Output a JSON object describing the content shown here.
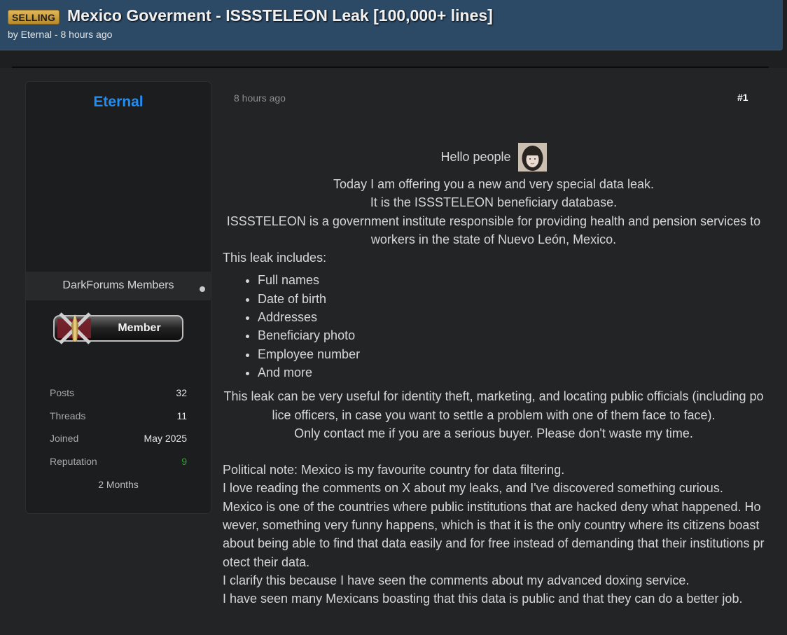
{
  "thread": {
    "prefix": "SELLING",
    "title": "Mexico Goverment - ISSSTELEON Leak [100,000+ lines]",
    "byline": "by Eternal - 8 hours ago"
  },
  "author": {
    "name": "Eternal",
    "group": "DarkForums Members",
    "badge_label": "Member",
    "stats": [
      {
        "key": "Posts",
        "value": "32"
      },
      {
        "key": "Threads",
        "value": "11"
      },
      {
        "key": "Joined",
        "value": "May 2025"
      },
      {
        "key": "Reputation",
        "value": "9"
      }
    ],
    "since": "2 Months"
  },
  "post": {
    "date": "8 hours ago",
    "number": "#1",
    "greeting": "Hello people",
    "intro_lines": [
      "Today I am offering you a new and very special data leak.",
      "It is the ISSSTELEON beneficiary database.",
      "ISSSTELEON is a government institute responsible for providing health and pension services to workers in the state of Nuevo León, Mexico."
    ],
    "includes_label": "This leak includes:",
    "includes": [
      "Full names",
      "Date of birth",
      "Addresses",
      "Beneficiary photo",
      "Employee number",
      "And more"
    ],
    "usage_lines": [
      "This leak can be very useful for identity theft, marketing, and locating public officials (including police officers, in case you want to settle a problem with one of them face to face).",
      "Only contact me if you are a serious buyer. Please don't waste my time."
    ],
    "notes": [
      "Political note: Mexico is my favourite country for data filtering.",
      "I love reading the comments on X about my leaks, and I've discovered something curious.",
      "Mexico is one of the countries where public institutions that are hacked deny what happened. However, something very funny happens, which is that it is the only country where its citizens boast about being able to find that data easily and for free instead of demanding that their institutions protect their data.",
      "I clarify this because I have seen the comments about my advanced doxing service.",
      "I have seen many Mexicans boasting that this data is public and that they can do a better job."
    ]
  },
  "colors": {
    "header_bg": "#2c4a66",
    "prefix_bg": "#d4a63c",
    "author_name": "#1f8ff5",
    "reputation": "#2aa52a",
    "page_bg": "#232425"
  }
}
